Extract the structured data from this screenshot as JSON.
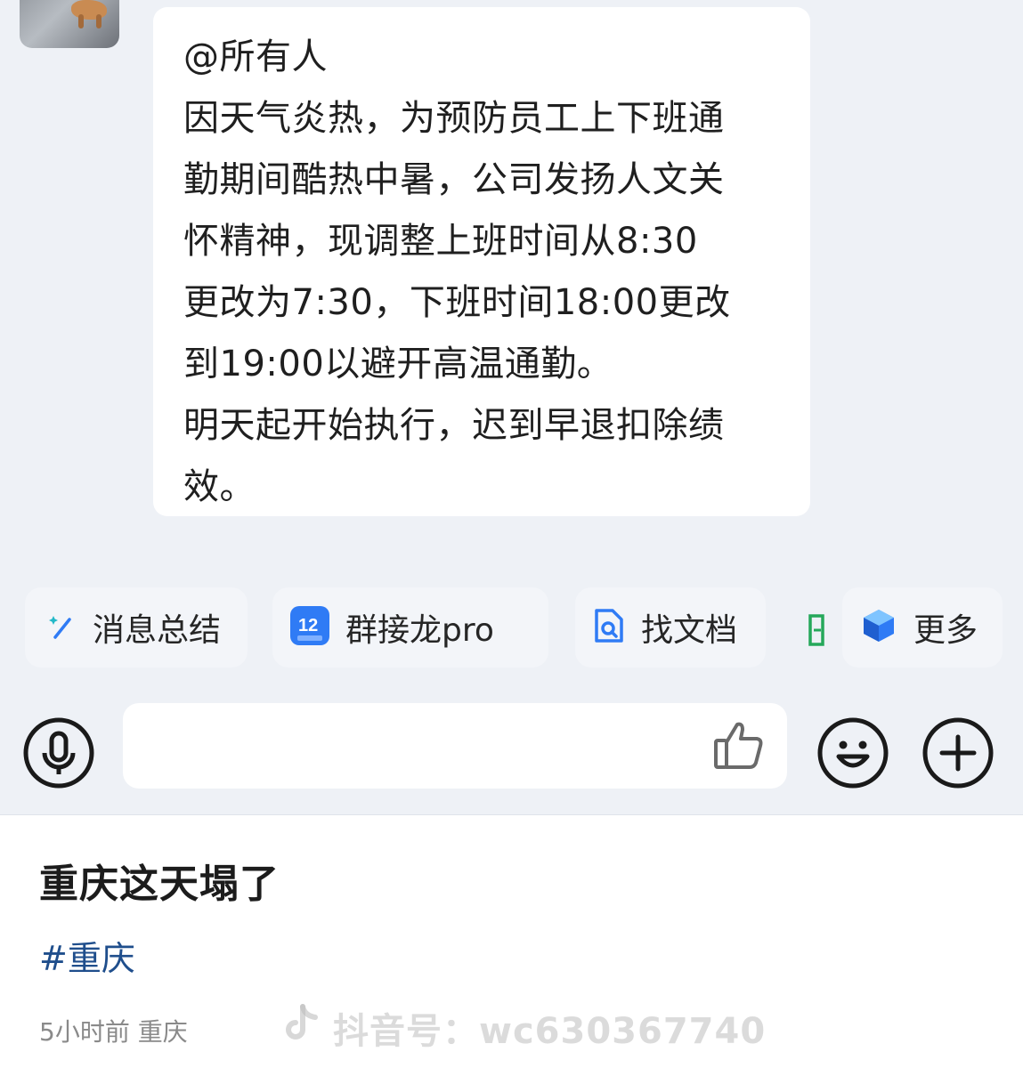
{
  "chat": {
    "message_lines": [
      "@所有人",
      "因天气炎热，为预防员工上下班通",
      "勤期间酷热中暑，公司发扬人文关",
      "怀精神，现调整上班时间从8:30",
      "更改为7:30，下班时间18:00更改",
      "到19:00以避开高温通勤。",
      "明天起开始执行，迟到早退扣除绩",
      "效。"
    ],
    "quick_actions": {
      "summary_label": "消息总结",
      "jielong_label": "群接龙pro",
      "docs_label": "找文档",
      "more_label": "更多"
    },
    "icons": {
      "mic": "microphone-icon",
      "thumb": "thumbs-up-icon",
      "emoji": "smiley-icon",
      "plus": "plus-icon"
    }
  },
  "post": {
    "title": "重庆这天塌了",
    "hashtag": "#重庆",
    "meta": "5小时前 重庆",
    "watermark": "抖音号：wc630367740"
  },
  "colors": {
    "chat_bg": "#eef1f6",
    "hashtag": "#1f4e8c",
    "jielong_icon": "#2f7bf5"
  }
}
